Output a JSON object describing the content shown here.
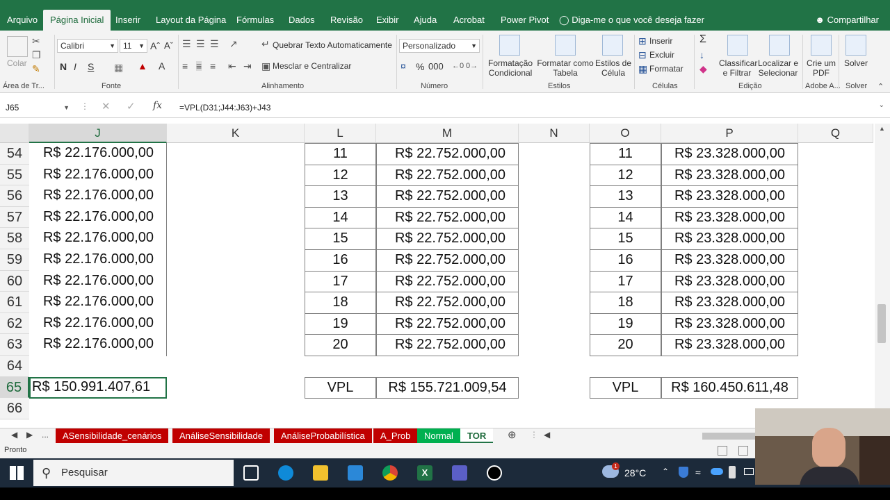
{
  "ribbon_tabs": [
    "Arquivo",
    "Página Inicial",
    "Inserir",
    "Layout da Página",
    "Fórmulas",
    "Dados",
    "Revisão",
    "Exibir",
    "Ajuda",
    "Acrobat",
    "Power Pivot"
  ],
  "tell_me": "Diga-me o que você deseja fazer",
  "share": "Compartilhar",
  "ribbon": {
    "paste": "Colar",
    "font_name": "Calibri",
    "font_size": "11",
    "bold": "N",
    "italic": "I",
    "underline": "S",
    "wrap_text": "Quebrar Texto Automaticamente",
    "merge_center": "Mesclar e Centralizar",
    "number_format": "Personalizado",
    "percent": "%",
    "thousands": "000",
    "cond_format": [
      "Formatação",
      "Condicional"
    ],
    "format_table": [
      "Formatar como",
      "Tabela"
    ],
    "cell_styles": [
      "Estilos de",
      "Célula"
    ],
    "insert": "Inserir",
    "delete": "Excluir",
    "format": "Formatar",
    "sort_filter": [
      "Classificar",
      "e Filtrar"
    ],
    "find_select": [
      "Localizar e",
      "Selecionar"
    ],
    "create_pdf": [
      "Crie um",
      "PDF"
    ],
    "solver": "Solver",
    "groups": [
      "Área de Tr...",
      "Fonte",
      "Alinhamento",
      "Número",
      "Estilos",
      "Células",
      "Edição",
      "Adobe A...",
      "Solver"
    ]
  },
  "name_box": "J65",
  "formula": "=VPL(D31;J44:J63)+J43",
  "columns": [
    "J",
    "K",
    "L",
    "M",
    "N",
    "O",
    "P",
    "Q"
  ],
  "rows": [
    {
      "row": "54",
      "j": "R$ 22.176.000,00",
      "l": "11",
      "m": "R$ 22.752.000,00",
      "o": "11",
      "p": "R$ 23.328.000,00"
    },
    {
      "row": "55",
      "j": "R$ 22.176.000,00",
      "l": "12",
      "m": "R$ 22.752.000,00",
      "o": "12",
      "p": "R$ 23.328.000,00"
    },
    {
      "row": "56",
      "j": "R$ 22.176.000,00",
      "l": "13",
      "m": "R$ 22.752.000,00",
      "o": "13",
      "p": "R$ 23.328.000,00"
    },
    {
      "row": "57",
      "j": "R$ 22.176.000,00",
      "l": "14",
      "m": "R$ 22.752.000,00",
      "o": "14",
      "p": "R$ 23.328.000,00"
    },
    {
      "row": "58",
      "j": "R$ 22.176.000,00",
      "l": "15",
      "m": "R$ 22.752.000,00",
      "o": "15",
      "p": "R$ 23.328.000,00"
    },
    {
      "row": "59",
      "j": "R$ 22.176.000,00",
      "l": "16",
      "m": "R$ 22.752.000,00",
      "o": "16",
      "p": "R$ 23.328.000,00"
    },
    {
      "row": "60",
      "j": "R$ 22.176.000,00",
      "l": "17",
      "m": "R$ 22.752.000,00",
      "o": "17",
      "p": "R$ 23.328.000,00"
    },
    {
      "row": "61",
      "j": "R$ 22.176.000,00",
      "l": "18",
      "m": "R$ 22.752.000,00",
      "o": "18",
      "p": "R$ 23.328.000,00"
    },
    {
      "row": "62",
      "j": "R$ 22.176.000,00",
      "l": "19",
      "m": "R$ 22.752.000,00",
      "o": "19",
      "p": "R$ 23.328.000,00"
    },
    {
      "row": "63",
      "j": "R$ 22.176.000,00",
      "l": "20",
      "m": "R$ 22.752.000,00",
      "o": "20",
      "p": "R$ 23.328.000,00"
    },
    {
      "row": "64"
    },
    {
      "row": "65",
      "j": "R$ 150.991.407,61",
      "l": "VPL",
      "m": "R$ 155.721.009,54",
      "o": "VPL",
      "p": "R$ 160.450.611,48"
    },
    {
      "row": "66"
    }
  ],
  "sheet_tabs": [
    {
      "label": "ASensibilidade_cenários",
      "color": "#c00000"
    },
    {
      "label": "AnáliseSensibilidade",
      "color": "#c00000"
    },
    {
      "label": "AnáliseProbabilística",
      "color": "#c00000"
    },
    {
      "label": "A_Prob",
      "color": "#c00000"
    },
    {
      "label": "Normal",
      "color": "#00b050"
    },
    {
      "label": "TOR",
      "color": "#ffffff"
    }
  ],
  "sheet_nav_more": "...",
  "status_text": "Pronto",
  "taskbar": {
    "search": "Pesquisar",
    "temperature": "28°C",
    "weather_badge": "1"
  },
  "colors": {
    "excel_green": "#217346",
    "tab_red": "#c00000",
    "tab_green": "#00b050"
  }
}
